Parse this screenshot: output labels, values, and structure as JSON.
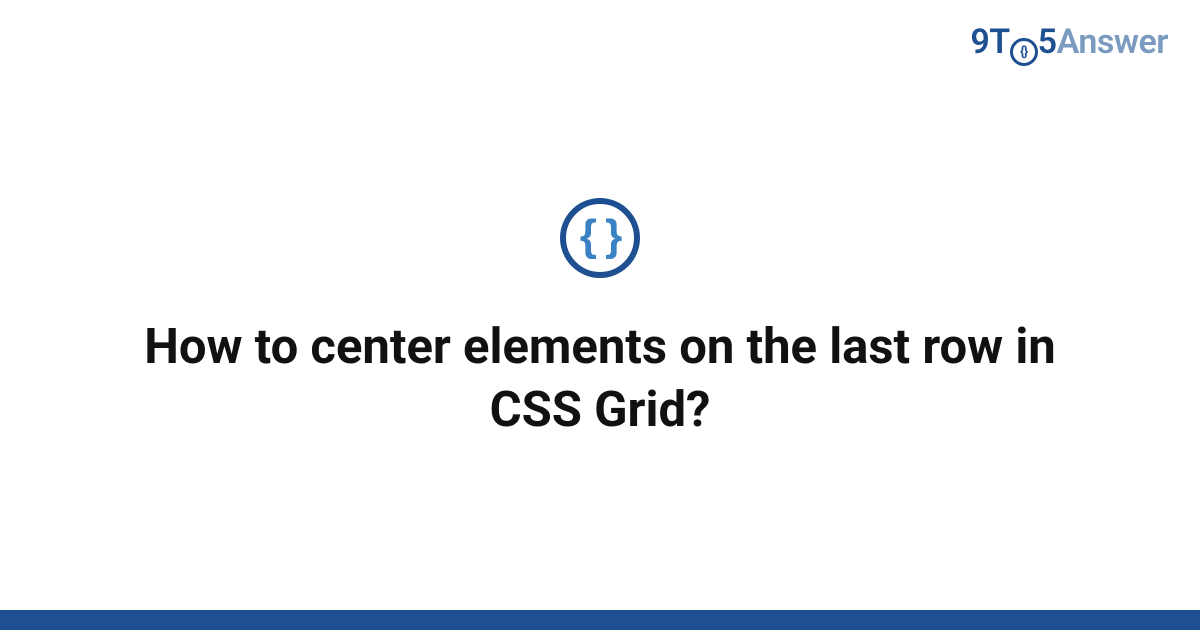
{
  "brand": {
    "nine": "9",
    "t": "T",
    "ring_inner": "{}",
    "five": "5",
    "answer": "Answer"
  },
  "topic_icon": {
    "glyph": "{ }",
    "name": "code-braces-icon"
  },
  "title": "How to center elements on the last row in CSS Grid?",
  "colors": {
    "brand_dark": "#1d4f91",
    "brand_light": "#7a9ac0",
    "icon_inner": "#3b82c4",
    "footer": "#1d4f91",
    "text": "#111111",
    "bg": "#ffffff"
  }
}
